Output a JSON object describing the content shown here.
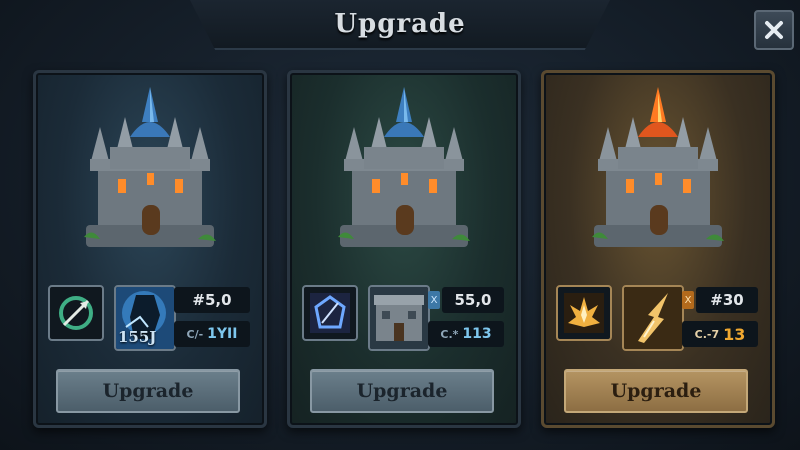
{
  "header": {
    "title": "Upgrade"
  },
  "colors": {
    "accent_blue": "#4aa3e0",
    "accent_gold": "#e49a2c",
    "flame": "#ff7a22"
  },
  "icons": [
    "close-icon",
    "crosshair-arrow-icon",
    "frost-wizard-icon",
    "arcane-rune-icon",
    "stone-wall-icon",
    "fire-burst-icon",
    "lightning-claw-icon"
  ],
  "cards": [
    {
      "icon_label": "155J",
      "stat1": "#5,0",
      "stat2_prefix": "C/-",
      "stat2_value": "1YII",
      "button_label": "Upgrade"
    },
    {
      "stat1": "55,0",
      "tag": "X",
      "stat2_prefix": "C.*",
      "stat2_value": "113",
      "button_label": "Upgrade"
    },
    {
      "stat1": "#30",
      "tag": "X",
      "stat2_prefix": "C.-7",
      "stat2_value": "13",
      "button_label": "Upgrade"
    }
  ]
}
